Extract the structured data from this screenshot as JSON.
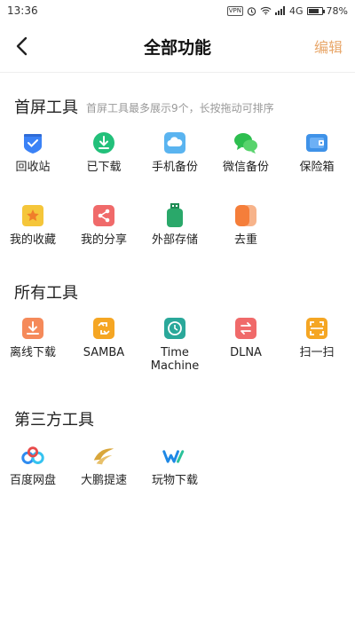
{
  "status_bar": {
    "time": "13:36",
    "vpn": "VPN",
    "network": "4G",
    "battery": "78%",
    "battery_level": 0.78
  },
  "header": {
    "title": "全部功能",
    "edit_label": "编辑"
  },
  "home_tools": {
    "title": "首屏工具",
    "hint": "首屏工具最多展示9个，长按拖动可排序",
    "items": [
      {
        "label": "回收站",
        "icon": "recycle-bin-icon",
        "color": "#3b82f6"
      },
      {
        "label": "已下载",
        "icon": "downloaded-icon",
        "color": "#22c07a"
      },
      {
        "label": "手机备份",
        "icon": "phone-backup-icon",
        "color": "#5ab4f0"
      },
      {
        "label": "微信备份",
        "icon": "wechat-backup-icon",
        "color": "#2dbe4f"
      },
      {
        "label": "保险箱",
        "icon": "safe-box-icon",
        "color": "#3f92e8"
      },
      {
        "label": "我的收藏",
        "icon": "favorites-icon",
        "color": "#f5c63a"
      },
      {
        "label": "我的分享",
        "icon": "share-icon",
        "color": "#f06a6a"
      },
      {
        "label": "外部存储",
        "icon": "external-storage-icon",
        "color": "#2aa86a"
      },
      {
        "label": "去重",
        "icon": "dedupe-icon",
        "color": "#f57e3a"
      }
    ]
  },
  "all_tools": {
    "title": "所有工具",
    "items": [
      {
        "label": "离线下载",
        "icon": "offline-download-icon",
        "color": "#f58a5a"
      },
      {
        "label": "SAMBA",
        "icon": "samba-icon",
        "color": "#f5a623"
      },
      {
        "label": "Time\nMachine",
        "icon": "time-machine-icon",
        "color": "#2aa89a"
      },
      {
        "label": "DLNA",
        "icon": "dlna-icon",
        "color": "#f06a6a"
      },
      {
        "label": "扫一扫",
        "icon": "scan-icon",
        "color": "#f5a623"
      }
    ]
  },
  "third_party_tools": {
    "title": "第三方工具",
    "items": [
      {
        "label": "百度网盘",
        "icon": "baidu-netdisk-icon"
      },
      {
        "label": "大鹏提速",
        "icon": "dapeng-speedup-icon"
      },
      {
        "label": "玩物下载",
        "icon": "wanwu-download-icon"
      }
    ]
  }
}
